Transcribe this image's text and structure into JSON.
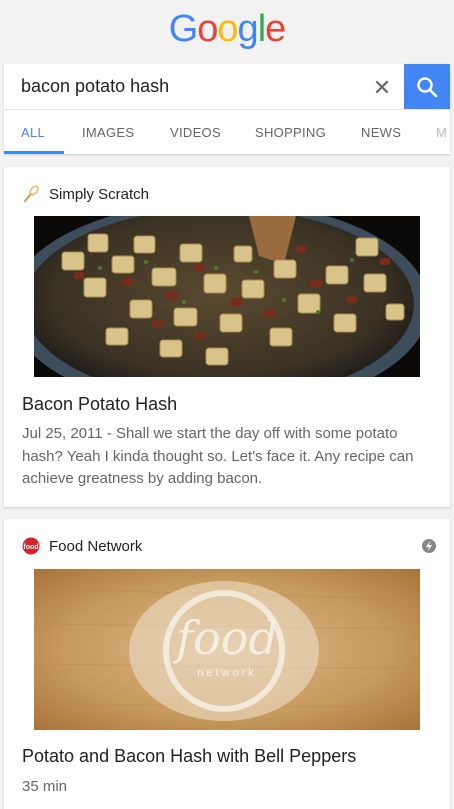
{
  "logo": {
    "letters": [
      "G",
      "o",
      "o",
      "g",
      "l",
      "e"
    ],
    "colors": [
      "#4285f4",
      "#ea4335",
      "#fbbc05",
      "#4285f4",
      "#34a853",
      "#ea4335"
    ]
  },
  "search": {
    "query": "bacon potato hash",
    "clear_glyph": "✕"
  },
  "tabs": [
    {
      "label": "ALL",
      "active": true
    },
    {
      "label": "IMAGES",
      "active": false
    },
    {
      "label": "VIDEOS",
      "active": false
    },
    {
      "label": "SHOPPING",
      "active": false
    },
    {
      "label": "NEWS",
      "active": false
    },
    {
      "label": "M",
      "active": false
    }
  ],
  "results": [
    {
      "source": "Simply Scratch",
      "icon": "whisk-icon",
      "title": "Bacon Potato Hash",
      "snippet": "Jul 25, 2011 - Shall we start the day off with some potato hash? Yeah I kinda thought so. Let's face it. Any recipe can achieve greatness by adding bacon."
    },
    {
      "source": "Food Network",
      "icon": "food-network-logo-icon",
      "image_text": "food",
      "image_subtext": "network",
      "title": "Potato and Bacon Hash with Bell Peppers",
      "snippet": "35 min"
    }
  ],
  "colors": {
    "accent": "#4285f4",
    "background": "#f2f2f2"
  }
}
